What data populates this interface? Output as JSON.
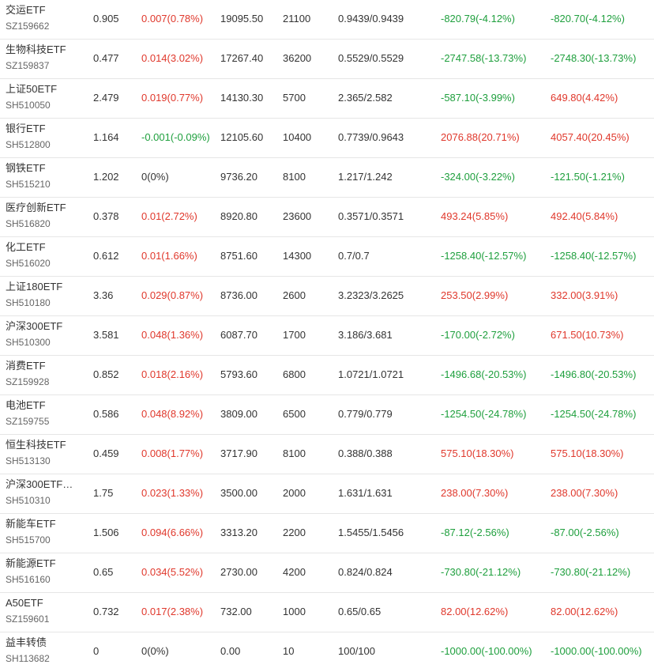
{
  "colors": {
    "up": "#e0382c",
    "down": "#1e9f3d",
    "flat": "#333333"
  },
  "rows": [
    {
      "name": "交运ETF",
      "code": "SZ159662",
      "price": "0.905",
      "change": "0.007(0.78%)",
      "change_dir": "up",
      "value": "19095.50",
      "qty": "21100",
      "cost": "0.9439/0.9439",
      "pl1": "-820.79(-4.12%)",
      "pl1_dir": "down",
      "pl2": "-820.70(-4.12%)",
      "pl2_dir": "down"
    },
    {
      "name": "生物科技ETF",
      "code": "SZ159837",
      "price": "0.477",
      "change": "0.014(3.02%)",
      "change_dir": "up",
      "value": "17267.40",
      "qty": "36200",
      "cost": "0.5529/0.5529",
      "pl1": "-2747.58(-13.73%)",
      "pl1_dir": "down",
      "pl2": "-2748.30(-13.73%)",
      "pl2_dir": "down"
    },
    {
      "name": "上证50ETF",
      "code": "SH510050",
      "price": "2.479",
      "change": "0.019(0.77%)",
      "change_dir": "up",
      "value": "14130.30",
      "qty": "5700",
      "cost": "2.365/2.582",
      "pl1": "-587.10(-3.99%)",
      "pl1_dir": "down",
      "pl2": "649.80(4.42%)",
      "pl2_dir": "up"
    },
    {
      "name": "银行ETF",
      "code": "SH512800",
      "price": "1.164",
      "change": "-0.001(-0.09%)",
      "change_dir": "down",
      "value": "12105.60",
      "qty": "10400",
      "cost": "0.7739/0.9643",
      "pl1": "2076.88(20.71%)",
      "pl1_dir": "up",
      "pl2": "4057.40(20.45%)",
      "pl2_dir": "up"
    },
    {
      "name": "钢铁ETF",
      "code": "SH515210",
      "price": "1.202",
      "change": "0(0%)",
      "change_dir": "flat",
      "value": "9736.20",
      "qty": "8100",
      "cost": "1.217/1.242",
      "pl1": "-324.00(-3.22%)",
      "pl1_dir": "down",
      "pl2": "-121.50(-1.21%)",
      "pl2_dir": "down"
    },
    {
      "name": "医疗创新ETF",
      "code": "SH516820",
      "price": "0.378",
      "change": "0.01(2.72%)",
      "change_dir": "up",
      "value": "8920.80",
      "qty": "23600",
      "cost": "0.3571/0.3571",
      "pl1": "493.24(5.85%)",
      "pl1_dir": "up",
      "pl2": "492.40(5.84%)",
      "pl2_dir": "up"
    },
    {
      "name": "化工ETF",
      "code": "SH516020",
      "price": "0.612",
      "change": "0.01(1.66%)",
      "change_dir": "up",
      "value": "8751.60",
      "qty": "14300",
      "cost": "0.7/0.7",
      "pl1": "-1258.40(-12.57%)",
      "pl1_dir": "down",
      "pl2": "-1258.40(-12.57%)",
      "pl2_dir": "down"
    },
    {
      "name": "上证180ETF",
      "code": "SH510180",
      "price": "3.36",
      "change": "0.029(0.87%)",
      "change_dir": "up",
      "value": "8736.00",
      "qty": "2600",
      "cost": "3.2323/3.2625",
      "pl1": "253.50(2.99%)",
      "pl1_dir": "up",
      "pl2": "332.00(3.91%)",
      "pl2_dir": "up"
    },
    {
      "name": "沪深300ETF",
      "code": "SH510300",
      "price": "3.581",
      "change": "0.048(1.36%)",
      "change_dir": "up",
      "value": "6087.70",
      "qty": "1700",
      "cost": "3.186/3.681",
      "pl1": "-170.00(-2.72%)",
      "pl1_dir": "down",
      "pl2": "671.50(10.73%)",
      "pl2_dir": "up"
    },
    {
      "name": "消费ETF",
      "code": "SZ159928",
      "price": "0.852",
      "change": "0.018(2.16%)",
      "change_dir": "up",
      "value": "5793.60",
      "qty": "6800",
      "cost": "1.0721/1.0721",
      "pl1": "-1496.68(-20.53%)",
      "pl1_dir": "down",
      "pl2": "-1496.80(-20.53%)",
      "pl2_dir": "down"
    },
    {
      "name": "电池ETF",
      "code": "SZ159755",
      "price": "0.586",
      "change": "0.048(8.92%)",
      "change_dir": "up",
      "value": "3809.00",
      "qty": "6500",
      "cost": "0.779/0.779",
      "pl1": "-1254.50(-24.78%)",
      "pl1_dir": "down",
      "pl2": "-1254.50(-24.78%)",
      "pl2_dir": "down"
    },
    {
      "name": "恒生科技ETF",
      "code": "SH513130",
      "price": "0.459",
      "change": "0.008(1.77%)",
      "change_dir": "up",
      "value": "3717.90",
      "qty": "8100",
      "cost": "0.388/0.388",
      "pl1": "575.10(18.30%)",
      "pl1_dir": "up",
      "pl2": "575.10(18.30%)",
      "pl2_dir": "up"
    },
    {
      "name": "沪深300ETF…",
      "code": "SH510310",
      "price": "1.75",
      "change": "0.023(1.33%)",
      "change_dir": "up",
      "value": "3500.00",
      "qty": "2000",
      "cost": "1.631/1.631",
      "pl1": "238.00(7.30%)",
      "pl1_dir": "up",
      "pl2": "238.00(7.30%)",
      "pl2_dir": "up"
    },
    {
      "name": "新能车ETF",
      "code": "SH515700",
      "price": "1.506",
      "change": "0.094(6.66%)",
      "change_dir": "up",
      "value": "3313.20",
      "qty": "2200",
      "cost": "1.5455/1.5456",
      "pl1": "-87.12(-2.56%)",
      "pl1_dir": "down",
      "pl2": "-87.00(-2.56%)",
      "pl2_dir": "down"
    },
    {
      "name": "新能源ETF",
      "code": "SH516160",
      "price": "0.65",
      "change": "0.034(5.52%)",
      "change_dir": "up",
      "value": "2730.00",
      "qty": "4200",
      "cost": "0.824/0.824",
      "pl1": "-730.80(-21.12%)",
      "pl1_dir": "down",
      "pl2": "-730.80(-21.12%)",
      "pl2_dir": "down"
    },
    {
      "name": "A50ETF",
      "code": "SZ159601",
      "price": "0.732",
      "change": "0.017(2.38%)",
      "change_dir": "up",
      "value": "732.00",
      "qty": "1000",
      "cost": "0.65/0.65",
      "pl1": "82.00(12.62%)",
      "pl1_dir": "up",
      "pl2": "82.00(12.62%)",
      "pl2_dir": "up"
    },
    {
      "name": "益丰转债",
      "code": "SH113682",
      "price": "0",
      "change": "0(0%)",
      "change_dir": "flat",
      "value": "0.00",
      "qty": "10",
      "cost": "100/100",
      "pl1": "-1000.00(-100.00%)",
      "pl1_dir": "down",
      "pl2": "-1000.00(-100.00%)",
      "pl2_dir": "down"
    }
  ]
}
